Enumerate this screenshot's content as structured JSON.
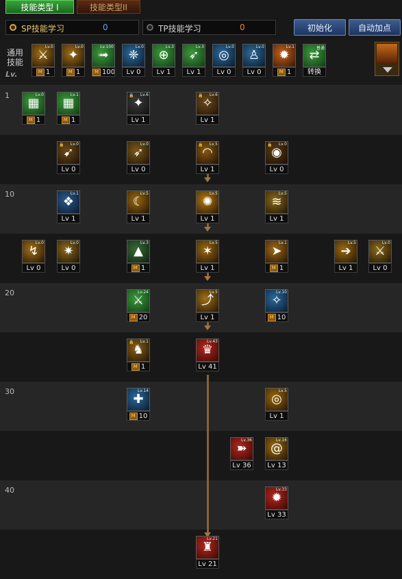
{
  "tabs": {
    "active": "技能类型 I",
    "inactive": "技能类型II"
  },
  "points": {
    "sp": {
      "label": "SP技能学习",
      "value": "0"
    },
    "tp": {
      "label": "TP技能学习",
      "value": "0"
    }
  },
  "buttons": {
    "reset": "初始化",
    "auto": "自动加点"
  },
  "common": {
    "label_line1": "通用",
    "label_line2": "技能",
    "lv_label": "Lv.",
    "skills": [
      {
        "lvl": "Lv.0",
        "cap": "1",
        "m": true,
        "icon": "sword-slash-icon"
      },
      {
        "lvl": "Lv.0",
        "cap": "1",
        "m": true,
        "icon": "claw-icon"
      },
      {
        "lvl": "Lv.100",
        "cap": "100",
        "m": true,
        "icon": "dash-icon"
      },
      {
        "lvl": "Lv.0",
        "cap": "Lv 0",
        "m": false,
        "icon": "wings-icon"
      },
      {
        "lvl": "Lv.3",
        "cap": "Lv 1",
        "m": false,
        "icon": "target-icon"
      },
      {
        "lvl": "Lv.3",
        "cap": "Lv 1",
        "m": false,
        "icon": "running-icon"
      },
      {
        "lvl": "Lv.0",
        "cap": "Lv 0",
        "m": false,
        "icon": "vortex-icon"
      },
      {
        "lvl": "Lv.0",
        "cap": "Lv 0",
        "m": false,
        "icon": "figure-icon"
      },
      {
        "lvl": "Lv.1",
        "cap": "1",
        "m": true,
        "icon": "flame-icon"
      },
      {
        "lvl": "普通",
        "cap": "转换",
        "m": false,
        "icon": "switch-icon"
      }
    ]
  },
  "row_labels": [
    "1",
    "10",
    "20",
    "30",
    "40"
  ],
  "skills": [
    {
      "lvl": "Lv.0",
      "cap": "1",
      "m": true,
      "lock": false,
      "icon": "green-rune-icon"
    },
    {
      "lvl": "Lv.1",
      "cap": "1",
      "m": true,
      "lock": false,
      "icon": "green-rune-icon"
    },
    {
      "lvl": "Lv.6",
      "cap": "Lv 1",
      "m": false,
      "lock": true,
      "icon": "blade-icon"
    },
    {
      "lvl": "Lv.6",
      "cap": "Lv 1",
      "m": false,
      "lock": true,
      "icon": "strike-icon"
    },
    {
      "lvl": "Lv.0",
      "cap": "Lv 0",
      "m": false,
      "lock": true,
      "icon": "kick-icon"
    },
    {
      "lvl": "Lv.0",
      "cap": "Lv 0",
      "m": false,
      "lock": false,
      "icon": "runner-icon"
    },
    {
      "lvl": "Lv.5",
      "cap": "Lv 1",
      "m": false,
      "lock": true,
      "icon": "arc-slash-icon"
    },
    {
      "lvl": "Lv.0",
      "cap": "Lv 0",
      "m": false,
      "lock": true,
      "icon": "orb-icon"
    },
    {
      "lvl": "Lv.1",
      "cap": "Lv 1",
      "m": false,
      "lock": false,
      "icon": "crystal-icon"
    },
    {
      "lvl": "Lv.5",
      "cap": "Lv 1",
      "m": false,
      "lock": false,
      "icon": "crescent-icon"
    },
    {
      "lvl": "Lv.5",
      "cap": "Lv 1",
      "m": false,
      "lock": false,
      "icon": "burst-icon"
    },
    {
      "lvl": "Lv.5",
      "cap": "Lv 1",
      "m": false,
      "lock": false,
      "icon": "wave-icon"
    },
    {
      "lvl": "Lv.0",
      "cap": "Lv 0",
      "m": false,
      "lock": false,
      "icon": "leap-icon"
    },
    {
      "lvl": "Lv.0",
      "cap": "Lv 0",
      "m": false,
      "lock": false,
      "icon": "spin-icon"
    },
    {
      "lvl": "Lv.3",
      "cap": "1",
      "m": true,
      "lock": false,
      "icon": "hood-icon"
    },
    {
      "lvl": "Lv.5",
      "cap": "Lv 1",
      "m": false,
      "lock": false,
      "icon": "flurry-icon"
    },
    {
      "lvl": "Lv.1",
      "cap": "1",
      "m": true,
      "lock": false,
      "icon": "sprint-icon"
    },
    {
      "lvl": "Lv.5",
      "cap": "Lv 1",
      "m": false,
      "lock": false,
      "icon": "rush-icon"
    },
    {
      "lvl": "Lv.0",
      "cap": "Lv 0",
      "m": false,
      "lock": false,
      "icon": "slash-icon"
    },
    {
      "lvl": "Lv.24",
      "cap": "20",
      "m": true,
      "lock": false,
      "icon": "green-sword-icon"
    },
    {
      "lvl": "Lv.5",
      "cap": "Lv 1",
      "m": false,
      "lock": false,
      "icon": "uppercut-icon"
    },
    {
      "lvl": "Lv.10",
      "cap": "10",
      "m": true,
      "lock": false,
      "icon": "aura-icon"
    },
    {
      "lvl": "Lv.1",
      "cap": "1",
      "m": true,
      "lock": true,
      "icon": "stance-icon"
    },
    {
      "lvl": "Lv.43",
      "cap": "Lv 41",
      "m": false,
      "lock": false,
      "icon": "red-fighter-icon"
    },
    {
      "lvl": "Lv.14",
      "cap": "10",
      "m": true,
      "lock": false,
      "icon": "cross-icon"
    },
    {
      "lvl": "Lv.5",
      "cap": "Lv 1",
      "m": false,
      "lock": false,
      "icon": "whirl-icon"
    },
    {
      "lvl": "Lv.36",
      "cap": "Lv 36",
      "m": false,
      "lock": false,
      "icon": "red-dash-icon"
    },
    {
      "lvl": "Lv.16",
      "cap": "Lv 13",
      "m": false,
      "lock": false,
      "icon": "swirl-icon"
    },
    {
      "lvl": "Lv.33",
      "cap": "Lv 33",
      "m": false,
      "lock": false,
      "icon": "red-spin-icon"
    },
    {
      "lvl": "Lv.21",
      "cap": "Lv 21",
      "m": false,
      "lock": false,
      "icon": "red-final-icon"
    }
  ]
}
